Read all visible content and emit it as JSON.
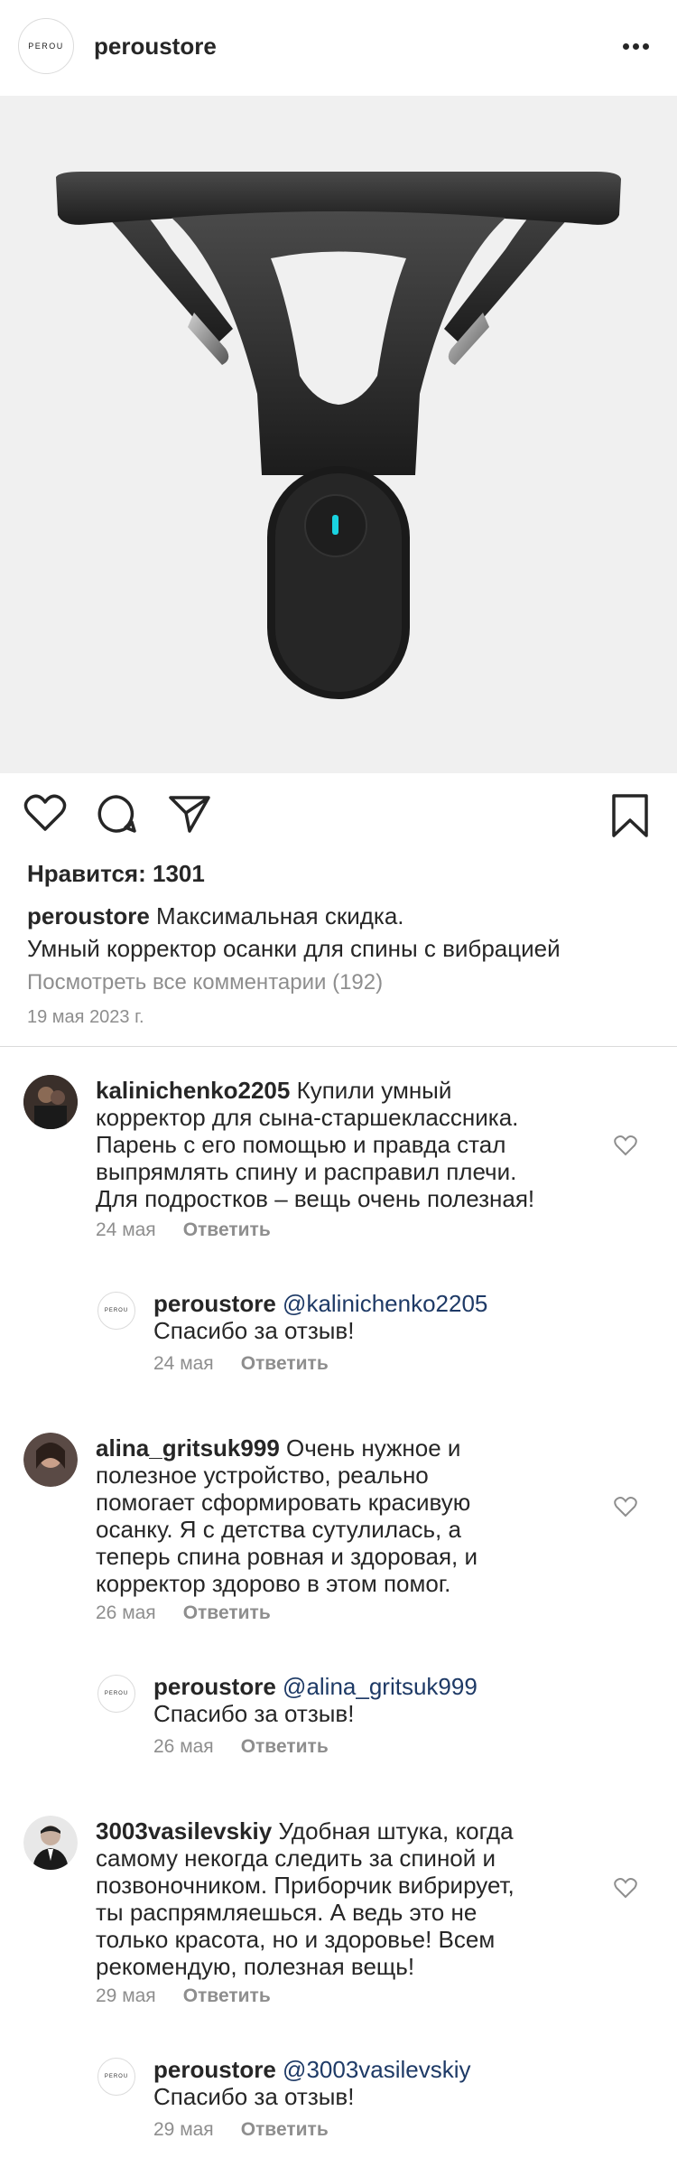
{
  "header": {
    "logo_text": "PEROU",
    "username": "peroustore"
  },
  "post": {
    "likes": "Нравится: 1301",
    "caption_user": "peroustore",
    "caption_line1": "Максимальная скидка.",
    "caption_line2": "Умный корректор осанки для спины с вибрацией",
    "view_comments": "Посмотреть все комментарии (192)",
    "date": "19 мая 2023 г."
  },
  "comments": [
    {
      "user": "kalinichenko2205",
      "lines": [
        "Купили умный",
        "корректор для сына-старшеклассника.",
        "Парень с его помощью и правда стал",
        "выпрямлять спину и расправил плечи.",
        "Для подростков – вещь очень полезная!"
      ],
      "date": "24 мая",
      "reply_label": "Ответить",
      "reply": {
        "user": "peroustore",
        "mention": "@kalinichenko2205",
        "text": "Спасибо за отзыв!",
        "date": "24 мая",
        "reply_label": "Ответить"
      }
    },
    {
      "user": "alina_gritsuk999",
      "lines": [
        "Очень нужное и",
        "полезное устройство, реально",
        "помогает сформировать красивую",
        "осанку. Я с детства сутулилась, а",
        "теперь спина ровная и здоровая, и",
        "корректор здорово в этом помог."
      ],
      "date": "26 мая",
      "reply_label": "Ответить",
      "reply": {
        "user": "peroustore",
        "mention": "@alina_gritsuk999",
        "text": "Спасибо за отзыв!",
        "date": "26 мая",
        "reply_label": "Ответить"
      }
    },
    {
      "user": "3003vasilevskiy",
      "lines": [
        "Удобная штука, когда",
        "самому некогда следить за спиной и",
        "позвоночником. Приборчик вибрирует,",
        "ты распрямляешься. А ведь это не",
        "только красота, но и здоровье! Всем",
        "рекомендую, полезная вещь!"
      ],
      "date": "29 мая",
      "reply_label": "Ответить",
      "reply": {
        "user": "peroustore",
        "mention": "@3003vasilevskiy",
        "text": "Спасибо за отзыв!",
        "date": "29 мая",
        "reply_label": "Ответить"
      }
    }
  ],
  "colors": {
    "indicator": "#19d3e0",
    "mention": "#1e3a66",
    "meta_gray": "#8e8e8e"
  }
}
